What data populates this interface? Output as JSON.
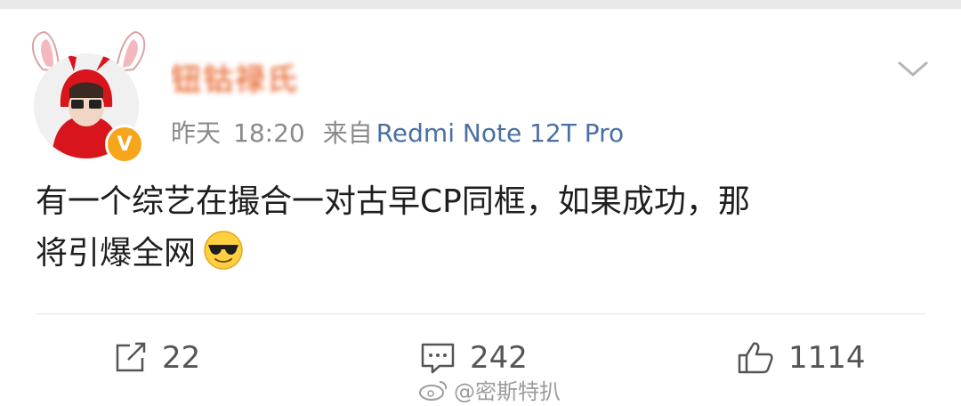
{
  "post": {
    "username": "钮钴禄氏",
    "date": "昨天",
    "time": "18:20",
    "source_prefix": "来自",
    "device": "Redmi Note 12T Pro",
    "text_line1": "有一个综艺在撮合一对古早CP同框，如果成功，那",
    "text_line2": "将引爆全网",
    "emoji": "sunglasses-emoji"
  },
  "actions": {
    "repost_count": "22",
    "comment_count": "242",
    "like_count": "1114"
  },
  "watermark": {
    "text": "@密斯特扒"
  },
  "colors": {
    "username": "#e8652c",
    "device": "#4a6fa5",
    "verified_badge": "#f7a61b"
  }
}
